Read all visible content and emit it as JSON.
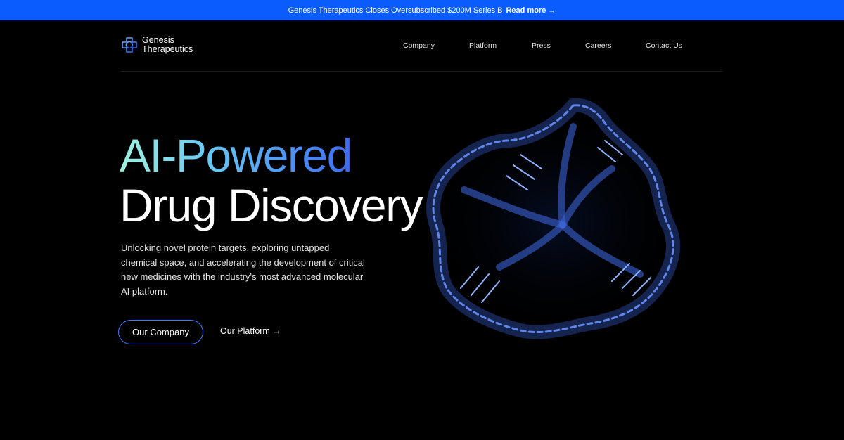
{
  "banner": {
    "text": "Genesis Therapeutics Closes Oversubscribed $200M Series B",
    "link_label": "Read more →"
  },
  "nav": {
    "logo_line1": "Genesis",
    "logo_line2": "Therapeutics",
    "links": [
      "Company",
      "Platform",
      "Press",
      "Careers",
      "Contact Us"
    ]
  },
  "hero": {
    "title_line1": "AI-Powered",
    "title_line2": "Drug Discovery",
    "description": "Unlocking novel protein targets, exploring untapped chemical space, and accelerating the development of critical new medicines with the industry's most advanced molecular AI platform.",
    "primary_button": "Our Company",
    "secondary_link": "Our Platform →"
  },
  "colors": {
    "banner_bg": "#0b5cff",
    "accent": "#3c7bff",
    "gradient_start": "#9ff2e0",
    "gradient_end": "#3c6bf2"
  }
}
